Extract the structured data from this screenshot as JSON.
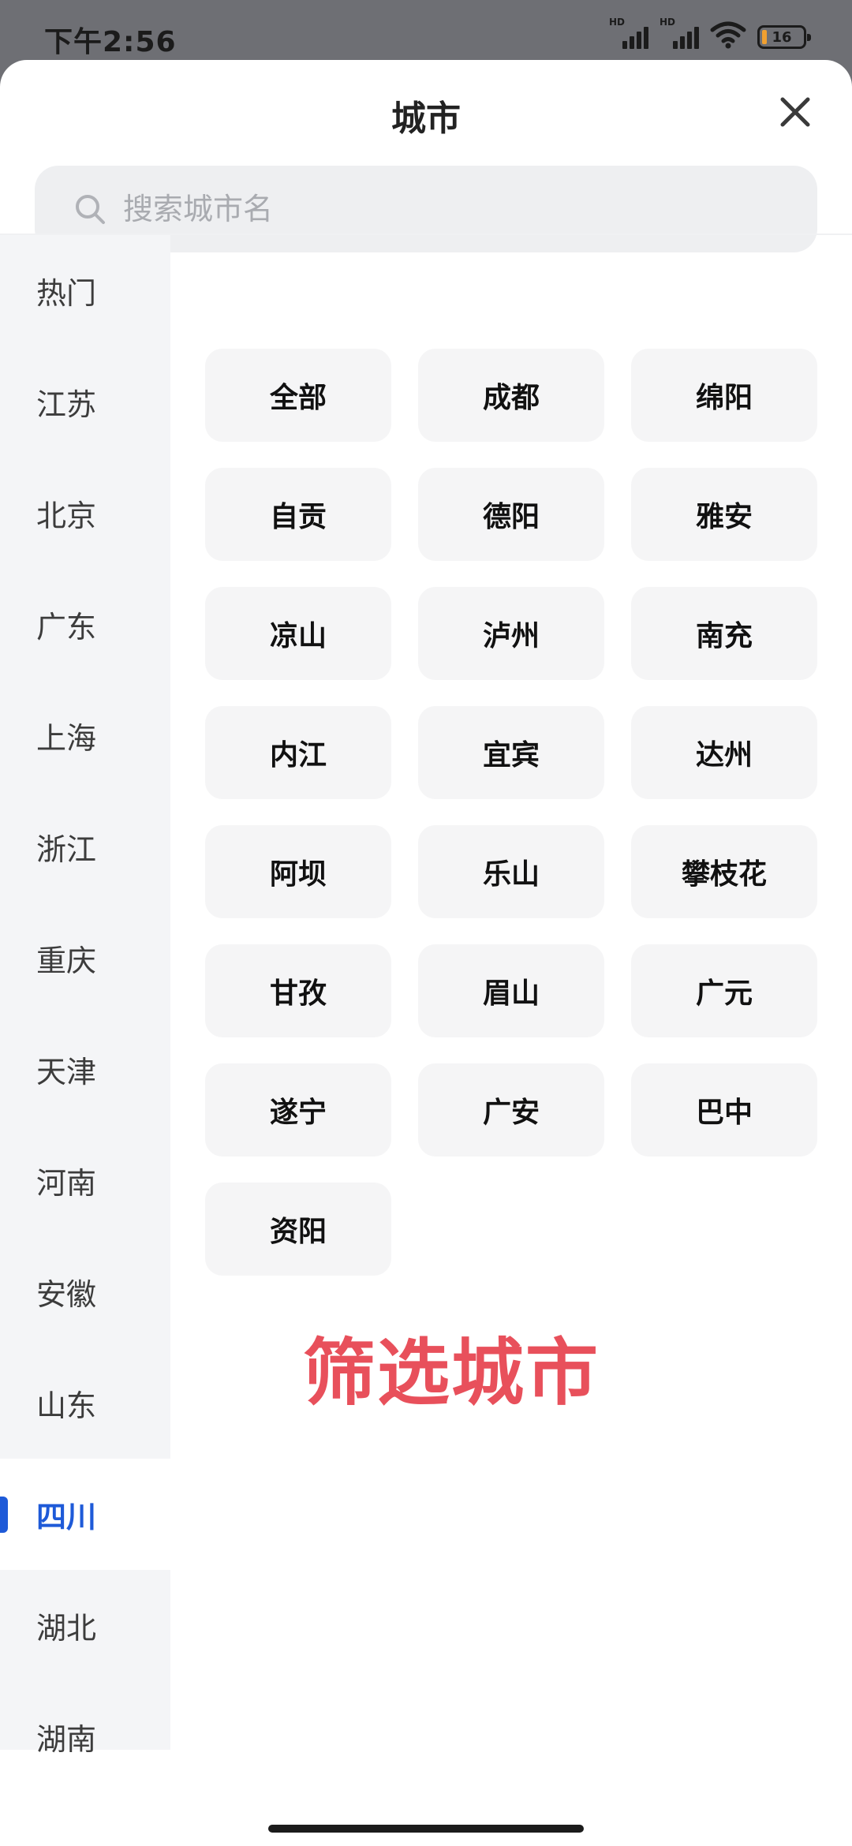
{
  "status_bar": {
    "time": "下午2:56",
    "network_1": "HD",
    "network_2": "HD",
    "battery_level": "16"
  },
  "sheet": {
    "title": "城市",
    "close_icon": "close-icon"
  },
  "search": {
    "placeholder": "搜索城市名",
    "value": "",
    "icon": "search-icon"
  },
  "side_nav": {
    "items": [
      {
        "label": "热门",
        "active": false
      },
      {
        "label": "江苏",
        "active": false
      },
      {
        "label": "北京",
        "active": false
      },
      {
        "label": "广东",
        "active": false
      },
      {
        "label": "上海",
        "active": false
      },
      {
        "label": "浙江",
        "active": false
      },
      {
        "label": "重庆",
        "active": false
      },
      {
        "label": "天津",
        "active": false
      },
      {
        "label": "河南",
        "active": false
      },
      {
        "label": "安徽",
        "active": false
      },
      {
        "label": "山东",
        "active": false
      },
      {
        "label": "四川",
        "active": true
      },
      {
        "label": "湖北",
        "active": false
      },
      {
        "label": "湖南",
        "active": false
      }
    ]
  },
  "cities": [
    "全部",
    "成都",
    "绵阳",
    "自贡",
    "德阳",
    "雅安",
    "凉山",
    "泸州",
    "南充",
    "内江",
    "宜宾",
    "达州",
    "阿坝",
    "乐山",
    "攀枝花",
    "甘孜",
    "眉山",
    "广元",
    "遂宁",
    "广安",
    "巴中",
    "资阳"
  ],
  "annotation": "筛选城市",
  "colors": {
    "accent": "#1e5ad8",
    "annotation": "#e8505b",
    "sidebar_bg": "#f4f5f7",
    "chip_bg": "#f5f5f6"
  }
}
